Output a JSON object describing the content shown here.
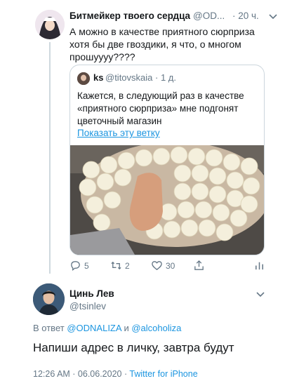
{
  "tweet": {
    "author_name": "Битмейкер твоего сердца",
    "author_handle": "@OD...",
    "time": "· 20 ч.",
    "text": "А можно в качестве приятного сюрприза\nхотя бы две гвоздики, я что, о многом\nпрошуууу????",
    "quote": {
      "author_name": "ks",
      "author_handle": "@titovskaia · 1 д.",
      "text": "Кажется, в следующий раз в качестве\n«приятного сюрприза» мне подгонят\nцветочный магазин",
      "show_thread": "Показать эту ветку"
    },
    "actions": {
      "replies": "5",
      "retweets": "2",
      "likes": "30"
    }
  },
  "reply": {
    "author_name": "Цинь Лев",
    "author_handle": "@tsinlev",
    "replying_prefix": "В ответ",
    "mention1": "@ODNALIZA",
    "conj": "и",
    "mention2": "@alcoholiza",
    "text": "Напиши адрес в личку, завтра будут",
    "timestamp": "12:26 AM · 06.06.2020 ·",
    "source": "Twitter for iPhone"
  },
  "colors": {
    "link": "#1b95e0",
    "muted": "#657786",
    "border": "#ccd6dd"
  },
  "icons": [
    "reply-icon",
    "retweet-icon",
    "like-icon",
    "share-icon",
    "analytics-icon",
    "chevron-down-icon"
  ]
}
